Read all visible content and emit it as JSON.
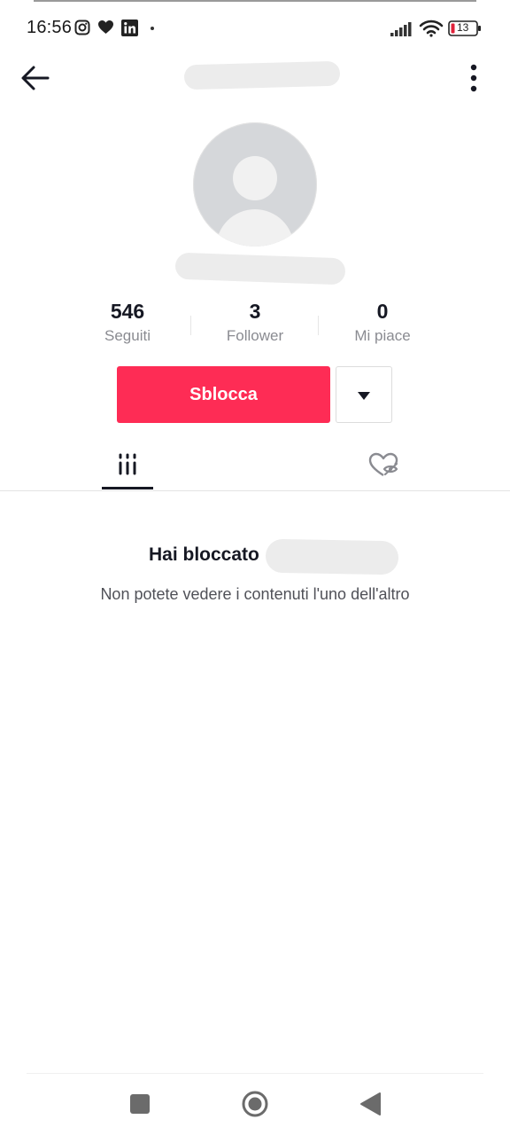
{
  "status_bar": {
    "time": "16:56",
    "battery_level": "13",
    "icons": [
      "instagram-icon",
      "heart-icon",
      "linkedin-icon",
      "signal-icon",
      "wifi-icon",
      "battery-icon"
    ]
  },
  "profile": {
    "stats": [
      {
        "value": "546",
        "label": "Seguiti"
      },
      {
        "value": "3",
        "label": "Follower"
      },
      {
        "value": "0",
        "label": "Mi piace"
      }
    ],
    "unblock_label": "Sblocca"
  },
  "tabs": [
    {
      "icon": "grid-icon",
      "active": true
    },
    {
      "icon": "liked-hidden-icon",
      "active": false
    }
  ],
  "blocked": {
    "title": "Hai bloccato",
    "message": "Non potete vedere i contenuti l'uno dell'altro"
  },
  "nav_bar": {
    "icons": [
      "recents-icon",
      "home-icon",
      "back-triangle-icon"
    ]
  },
  "colors": {
    "accent": "#fe2c55",
    "text_primary": "#161823",
    "text_secondary": "#8a8b91"
  }
}
